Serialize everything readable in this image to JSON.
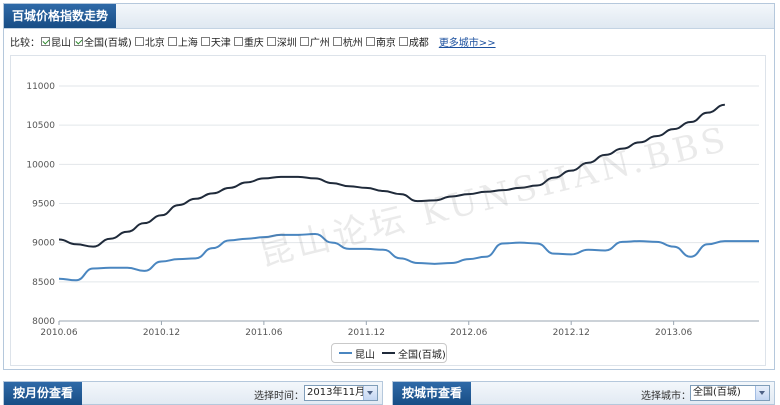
{
  "header": {
    "title": "百城价格指数走势"
  },
  "compare": {
    "label": "比较：",
    "cities": [
      {
        "name": "昆山",
        "checked": true
      },
      {
        "name": "全国(百城)",
        "checked": true
      },
      {
        "name": "北京",
        "checked": false
      },
      {
        "name": "上海",
        "checked": false
      },
      {
        "name": "天津",
        "checked": false
      },
      {
        "name": "重庆",
        "checked": false
      },
      {
        "name": "深圳",
        "checked": false
      },
      {
        "name": "广州",
        "checked": false
      },
      {
        "name": "杭州",
        "checked": false
      },
      {
        "name": "南京",
        "checked": false
      },
      {
        "name": "成都",
        "checked": false
      }
    ],
    "more_link": "更多城市>>"
  },
  "chart_data": {
    "type": "line",
    "x": [
      "2010.06",
      "2010.07",
      "2010.08",
      "2010.09",
      "2010.10",
      "2010.11",
      "2010.12",
      "2011.01",
      "2011.02",
      "2011.03",
      "2011.04",
      "2011.05",
      "2011.06",
      "2011.07",
      "2011.08",
      "2011.09",
      "2011.10",
      "2011.11",
      "2011.12",
      "2012.01",
      "2012.02",
      "2012.03",
      "2012.04",
      "2012.05",
      "2012.06",
      "2012.07",
      "2012.08",
      "2012.09",
      "2012.10",
      "2012.11",
      "2012.12",
      "2013.01",
      "2013.02",
      "2013.03",
      "2013.04",
      "2013.05",
      "2013.06",
      "2013.07",
      "2013.08",
      "2013.09",
      "2013.10",
      "2013.11"
    ],
    "x_tick_labels": [
      "2010.06",
      "2010.12",
      "2011.06",
      "2011.12",
      "2012.06",
      "2012.12",
      "2013.06"
    ],
    "ylim": [
      8000,
      11000
    ],
    "y_ticks": [
      8000,
      8500,
      9000,
      9500,
      10000,
      10500,
      11000
    ],
    "grid": "horizontal",
    "legend": "bottom-center",
    "series": [
      {
        "name": "昆山",
        "color": "#4a86c0",
        "values": [
          8540,
          8520,
          8670,
          8680,
          8680,
          8640,
          8760,
          8790,
          8800,
          8930,
          9030,
          9050,
          9070,
          9100,
          9100,
          9110,
          9000,
          8920,
          8920,
          8910,
          8800,
          8740,
          8730,
          8740,
          8790,
          8820,
          8990,
          9000,
          8990,
          8860,
          8850,
          8910,
          8900,
          9010,
          9020,
          9010,
          8950,
          8820,
          8980,
          9020,
          9020,
          9020
        ]
      },
      {
        "name": "全国(百城)",
        "color": "#1f2a3a",
        "values": [
          9040,
          8980,
          8950,
          9050,
          9140,
          9250,
          9350,
          9480,
          9560,
          9630,
          9700,
          9770,
          9820,
          9840,
          9840,
          9820,
          9760,
          9720,
          9700,
          9660,
          9620,
          9530,
          9540,
          9590,
          9620,
          9650,
          9670,
          9700,
          9730,
          9830,
          9920,
          10020,
          10120,
          10200,
          10280,
          10360,
          10450,
          10540,
          10660,
          10760
        ]
      }
    ]
  },
  "watermark": "昆山论坛 KUNSHAN.BBS",
  "bottom_left": {
    "title": "按月份查看",
    "label": "选择时间：",
    "select_value": "2013年11月"
  },
  "bottom_right": {
    "title": "按城市查看",
    "label": "选择城市：",
    "select_value": "全国(百城)"
  }
}
